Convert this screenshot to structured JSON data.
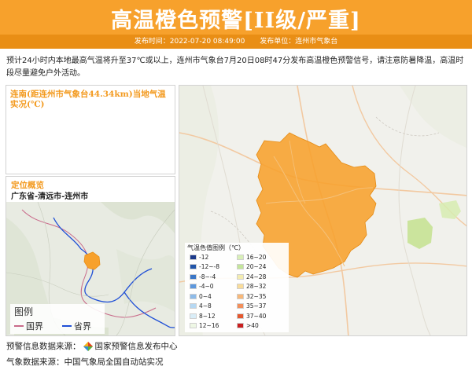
{
  "banner": {
    "title": "高温橙色预警[II级/严重]",
    "publish_time_label": "发布时间：2022-07-20 08:49:00",
    "publisher_label": "发布单位：连州市气象台",
    "color": "#f7a12c"
  },
  "description": "预计24小时内本地最高气温将升至37℃或以上，连州市气象台7月20日08时47分发布高温橙色预警信号，请注意防暑降温，高温时段尽量避免户外活动。",
  "live_panel": {
    "title": "连南(距连州市气象台44.34km)当地气温实况(℃)"
  },
  "location_panel": {
    "title": "定位概览",
    "region": "广东省-清远市-连州市",
    "legend": {
      "title": "图例",
      "items": [
        {
          "label": "国界",
          "color": "#c96a8a"
        },
        {
          "label": "省界",
          "color": "#1f4fd6"
        }
      ]
    }
  },
  "map": {
    "warning_area_color": "#f7a12c",
    "legend_title": "气温色值图例（℃）",
    "legend_items": [
      {
        "label": "-12",
        "color": "#1c3a8a"
      },
      {
        "label": "-12~-8",
        "color": "#2255a8"
      },
      {
        "label": "-8~-4",
        "color": "#3a76c6"
      },
      {
        "label": "-4~0",
        "color": "#5e98dc"
      },
      {
        "label": "0~4",
        "color": "#8ebbe8"
      },
      {
        "label": "4~8",
        "color": "#b6d8f2"
      },
      {
        "label": "8~12",
        "color": "#d9edf7"
      },
      {
        "label": "12~16",
        "color": "#eef7e4"
      },
      {
        "label": "16~20",
        "color": "#d8efb7"
      },
      {
        "label": "20~24",
        "color": "#c4e59b"
      },
      {
        "label": "24~28",
        "color": "#f3ecb0"
      },
      {
        "label": "28~32",
        "color": "#f9dc9a"
      },
      {
        "label": "32~35",
        "color": "#f8b879"
      },
      {
        "label": "35~37",
        "color": "#f28f5b"
      },
      {
        "label": "37~40",
        "color": "#e4582f"
      },
      {
        "label": ">40",
        "color": "#c91f1f"
      }
    ]
  },
  "sources": {
    "warning_source": "预警信息数据来源：",
    "warning_source_org": "国家预警信息发布中心",
    "weather_source": "气象数据来源：中国气象局全国自动站实况"
  }
}
